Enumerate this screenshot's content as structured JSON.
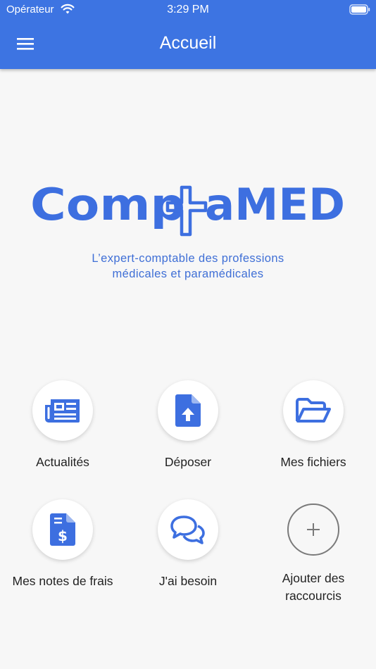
{
  "status_bar": {
    "carrier": "Opérateur",
    "time": "3:29 PM"
  },
  "nav": {
    "title": "Accueil"
  },
  "logo": {
    "text_left": "Comp",
    "text_right": "aMED",
    "brand": "ComptaMED"
  },
  "tagline": {
    "line1": "L’expert-comptable des professions",
    "line2": "médicales et paramédicales"
  },
  "shortcuts": [
    {
      "label": "Actualités",
      "icon": "newspaper-icon"
    },
    {
      "label": "Déposer",
      "icon": "file-upload-icon"
    },
    {
      "label": "Mes fichiers",
      "icon": "folder-open-icon"
    },
    {
      "label": "Mes notes de frais",
      "icon": "invoice-dollar-icon"
    },
    {
      "label": "J'ai besoin",
      "icon": "chat-bubbles-icon"
    },
    {
      "label": "Ajouter des raccourcis",
      "icon": "plus-icon"
    }
  ],
  "colors": {
    "primary": "#3d74e2",
    "background": "#f7f7f7",
    "icon": "#3d6fe0",
    "text": "#222222"
  }
}
